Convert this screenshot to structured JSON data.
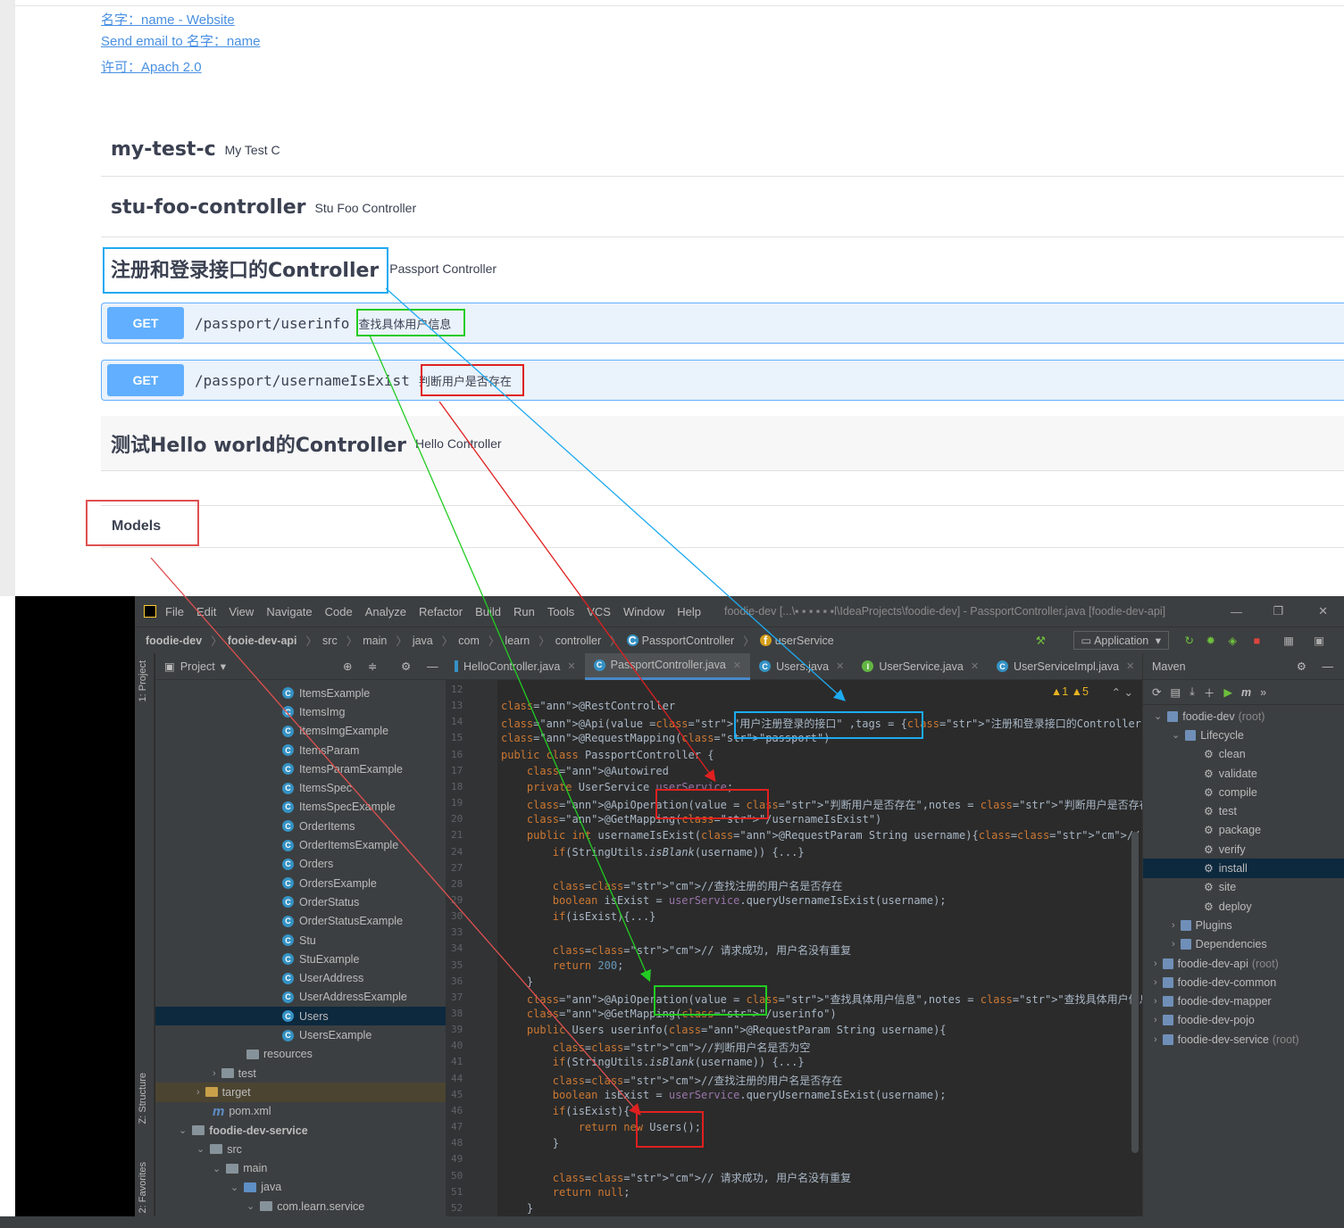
{
  "swagger": {
    "links": [
      "名字：name - Website",
      "Send email to 名字：name",
      "许可：Apach 2.0"
    ],
    "tags": [
      {
        "name": "my-test-c",
        "description": "My Test C"
      },
      {
        "name": "stu-foo-controller",
        "description": "Stu Foo Controller"
      },
      {
        "name": "注册和登录接口的Controller",
        "description": "Passport Controller"
      },
      {
        "name": "测试Hello world的Controller",
        "description": "Hello Controller"
      }
    ],
    "operations": [
      {
        "method": "GET",
        "path": "/passport/userinfo",
        "summary": "查找具体用户信息"
      },
      {
        "method": "GET",
        "path": "/passport/usernameIsExist",
        "summary": "判断用户是否存在"
      }
    ],
    "models_label": "Models"
  },
  "ide": {
    "menu": [
      "File",
      "Edit",
      "View",
      "Navigate",
      "Code",
      "Analyze",
      "Refactor",
      "Build",
      "Run",
      "Tools",
      "VCS",
      "Window",
      "Help"
    ],
    "window_title": "foodie-dev [...\\▪ ▪ ▪ ▪ ▪ ▪l\\IdeaProjects\\foodie-dev] - PassportController.java [foodie-dev-api]",
    "breadcrumb": [
      "foodie-dev",
      "fooie-dev-api",
      "src",
      "main",
      "java",
      "com",
      "learn",
      "controller",
      "PassportController",
      "userService"
    ],
    "run_config": "Application",
    "project_label": "Project",
    "side_labels": [
      "1: Project",
      "Z: Structure",
      "2: Favorites"
    ],
    "tree": [
      {
        "label": "ItemsExample",
        "kind": "class",
        "indent": 142
      },
      {
        "label": "ItemsImg",
        "kind": "class",
        "indent": 142
      },
      {
        "label": "ItemsImgExample",
        "kind": "class",
        "indent": 142
      },
      {
        "label": "ItemsParam",
        "kind": "class",
        "indent": 142
      },
      {
        "label": "ItemsParamExample",
        "kind": "class",
        "indent": 142
      },
      {
        "label": "ItemsSpec",
        "kind": "class",
        "indent": 142
      },
      {
        "label": "ItemsSpecExample",
        "kind": "class",
        "indent": 142
      },
      {
        "label": "OrderItems",
        "kind": "class",
        "indent": 142
      },
      {
        "label": "OrderItemsExample",
        "kind": "class",
        "indent": 142
      },
      {
        "label": "Orders",
        "kind": "class",
        "indent": 142
      },
      {
        "label": "OrdersExample",
        "kind": "class",
        "indent": 142
      },
      {
        "label": "OrderStatus",
        "kind": "class",
        "indent": 142
      },
      {
        "label": "OrderStatusExample",
        "kind": "class",
        "indent": 142
      },
      {
        "label": "Stu",
        "kind": "class",
        "indent": 142
      },
      {
        "label": "StuExample",
        "kind": "class",
        "indent": 142
      },
      {
        "label": "UserAddress",
        "kind": "class",
        "indent": 142
      },
      {
        "label": "UserAddressExample",
        "kind": "class",
        "indent": 142
      },
      {
        "label": "Users",
        "kind": "class",
        "indent": 142
      },
      {
        "label": "UsersExample",
        "kind": "class",
        "indent": 142
      },
      {
        "label": "resources",
        "kind": "folder",
        "indent": 102
      },
      {
        "label": "test",
        "kind": "folder-arrow",
        "indent": 64
      },
      {
        "label": "target",
        "kind": "folder-arrow",
        "indent": 46
      },
      {
        "label": "pom.xml",
        "kind": "maven",
        "indent": 64
      },
      {
        "label": "foodie-dev-service",
        "kind": "module",
        "indent": 26
      },
      {
        "label": "src",
        "kind": "folder-down",
        "indent": 46
      },
      {
        "label": "main",
        "kind": "folder-down",
        "indent": 64
      },
      {
        "label": "java",
        "kind": "folder-down",
        "indent": 84
      },
      {
        "label": "com.learn.service",
        "kind": "folder-down",
        "indent": 102
      }
    ],
    "tabs": [
      "HelloController.java",
      "PassportController.java",
      "Users.java",
      "UserService.java",
      "UserServiceImpl.java"
    ],
    "inspections": "▲1 ▲5",
    "line_numbers": [
      "12",
      "13",
      "14",
      "15",
      "16",
      "17",
      "18",
      "19",
      "20",
      "21",
      "24",
      "27",
      "28",
      "29",
      "30",
      "33",
      "34",
      "35",
      "36",
      "37",
      "38",
      "39",
      "40",
      "41",
      "44",
      "45",
      "46",
      "47",
      "48",
      "49",
      "50",
      "51",
      "52"
    ],
    "code": [
      "",
      "@RestController",
      "@Api(value =\"用户注册登录的接口\" ,tags = {\"注册和登录接口的Controller\"})",
      "@RequestMapping(\"passport\")",
      "public class PassportController {",
      "    @Autowired",
      "    private UserService userService;",
      "    @ApiOperation(value = \"判断用户是否存在\",notes = \"判断用户是否存在的接口\")",
      "    @GetMapping(\"/usernameIsExist\")",
      "    public int usernameIsExist(@RequestParam String username){//...",
      "        if(StringUtils.isBlank(username)) {...}",
      "",
      "        //查找注册的用户名是否存在",
      "        boolean isExist = userService.queryUsernameIsExist(username);",
      "        if(isExist){...}",
      "",
      "        // 请求成功, 用户名没有重复",
      "        return 200;",
      "    }",
      "    @ApiOperation(value = \"查找具体用户信息\",notes = \"查找具体用户信息的接口\")",
      "    @GetMapping(\"/userinfo\")",
      "    public Users userinfo(@RequestParam String username){",
      "        //判断用户名是否为空",
      "        if(StringUtils.isBlank(username)) {...}",
      "        //查找注册的用户名是否存在",
      "        boolean isExist = userService.queryUsernameIsExist(username);",
      "        if(isExist){",
      "            return new Users();",
      "        }",
      "",
      "        // 请求成功, 用户名没有重复",
      "        return null;",
      "    }"
    ],
    "maven_title": "Maven",
    "maven_tree": [
      {
        "label": "foodie-dev",
        "suffix": "(root)",
        "kind": "module-open",
        "indent": 12
      },
      {
        "label": "Lifecycle",
        "suffix": "",
        "kind": "group-open",
        "indent": 32
      },
      {
        "label": "clean",
        "suffix": "",
        "kind": "goal",
        "indent": 68
      },
      {
        "label": "validate",
        "suffix": "",
        "kind": "goal",
        "indent": 68
      },
      {
        "label": "compile",
        "suffix": "",
        "kind": "goal",
        "indent": 68
      },
      {
        "label": "test",
        "suffix": "",
        "kind": "goal",
        "indent": 68
      },
      {
        "label": "package",
        "suffix": "",
        "kind": "goal",
        "indent": 68
      },
      {
        "label": "verify",
        "suffix": "",
        "kind": "goal",
        "indent": 68
      },
      {
        "label": "install",
        "suffix": "",
        "kind": "goal",
        "indent": 68
      },
      {
        "label": "site",
        "suffix": "",
        "kind": "goal",
        "indent": 68
      },
      {
        "label": "deploy",
        "suffix": "",
        "kind": "goal",
        "indent": 68
      },
      {
        "label": "Plugins",
        "suffix": "",
        "kind": "group",
        "indent": 32
      },
      {
        "label": "Dependencies",
        "suffix": "",
        "kind": "group",
        "indent": 32
      },
      {
        "label": "foodie-dev-api",
        "suffix": "(root)",
        "kind": "module",
        "indent": 12
      },
      {
        "label": "foodie-dev-common",
        "suffix": "",
        "kind": "module",
        "indent": 12
      },
      {
        "label": "foodie-dev-mapper",
        "suffix": "",
        "kind": "module",
        "indent": 12
      },
      {
        "label": "foodie-dev-pojo",
        "suffix": "",
        "kind": "module",
        "indent": 12
      },
      {
        "label": "foodie-dev-service",
        "suffix": "(root)",
        "kind": "module",
        "indent": 12
      }
    ],
    "colors": {
      "accent": "#61affe",
      "cyan": "#1eaaf1",
      "green": "#22cc22",
      "red": "#e02020"
    }
  }
}
